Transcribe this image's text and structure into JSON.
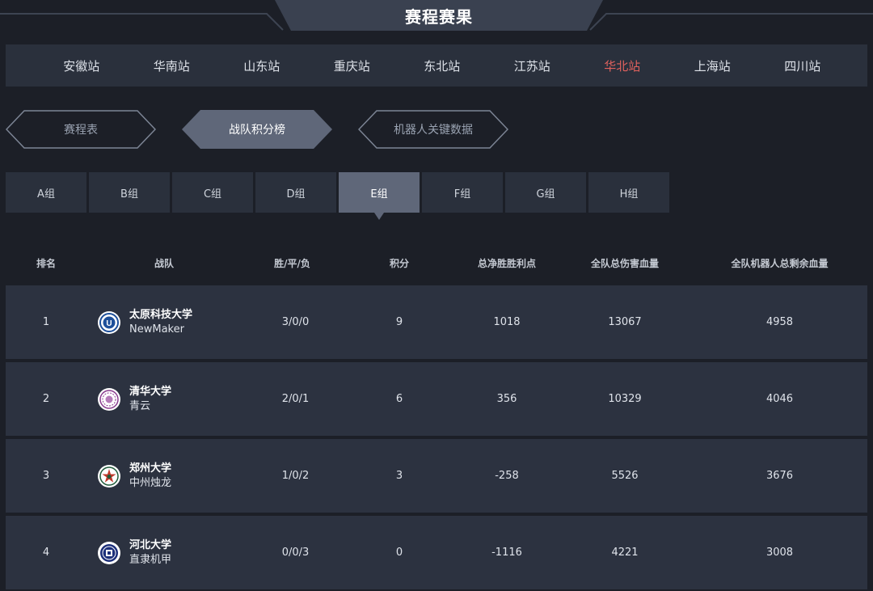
{
  "header": {
    "title": "赛程赛果"
  },
  "stations": [
    {
      "label": "安徽站",
      "active": false
    },
    {
      "label": "华南站",
      "active": false
    },
    {
      "label": "山东站",
      "active": false
    },
    {
      "label": "重庆站",
      "active": false
    },
    {
      "label": "东北站",
      "active": false
    },
    {
      "label": "江苏站",
      "active": false
    },
    {
      "label": "华北站",
      "active": true
    },
    {
      "label": "上海站",
      "active": false
    },
    {
      "label": "四川站",
      "active": false
    }
  ],
  "view_tabs": [
    {
      "label": "赛程表",
      "active": false
    },
    {
      "label": "战队积分榜",
      "active": true
    },
    {
      "label": "机器人关键数据",
      "active": false
    }
  ],
  "groups": [
    {
      "label": "A组",
      "active": false
    },
    {
      "label": "B组",
      "active": false
    },
    {
      "label": "C组",
      "active": false
    },
    {
      "label": "D组",
      "active": false
    },
    {
      "label": "E组",
      "active": true
    },
    {
      "label": "F组",
      "active": false
    },
    {
      "label": "G组",
      "active": false
    },
    {
      "label": "H组",
      "active": false
    }
  ],
  "table": {
    "headers": {
      "rank": "排名",
      "team": "战队",
      "wdl": "胜/平/负",
      "points": "积分",
      "net": "总净胜胜利点",
      "damage": "全队总伤害血量",
      "hp": "全队机器人总剩余血量"
    },
    "rows": [
      {
        "rank": "1",
        "school": "太原科技大学",
        "team": "NewMaker",
        "wdl": "3/0/0",
        "points": "9",
        "net": "1018",
        "damage": "13067",
        "hp": "4958",
        "logo_icon": "tyust-logo-icon",
        "logo_color": "#1d4f9a"
      },
      {
        "rank": "2",
        "school": "清华大学",
        "team": "青云",
        "wdl": "2/0/1",
        "points": "6",
        "net": "356",
        "damage": "10329",
        "hp": "4046",
        "logo_icon": "tsinghua-logo-icon",
        "logo_color": "#8a3d8f"
      },
      {
        "rank": "3",
        "school": "郑州大学",
        "team": "中州烛龙",
        "wdl": "1/0/2",
        "points": "3",
        "net": "-258",
        "damage": "5526",
        "hp": "3676",
        "logo_icon": "zzu-logo-icon",
        "logo_color": "#1f5a3a"
      },
      {
        "rank": "4",
        "school": "河北大学",
        "team": "直隶机甲",
        "wdl": "0/0/3",
        "points": "0",
        "net": "-1116",
        "damage": "4221",
        "hp": "3008",
        "logo_icon": "hbu-logo-icon",
        "logo_color": "#1c2f7a"
      }
    ]
  },
  "colors": {
    "background": "#1c1f27",
    "panel": "#2a303c",
    "active_station": "#e2625e",
    "active_tab": "#5f6779"
  }
}
